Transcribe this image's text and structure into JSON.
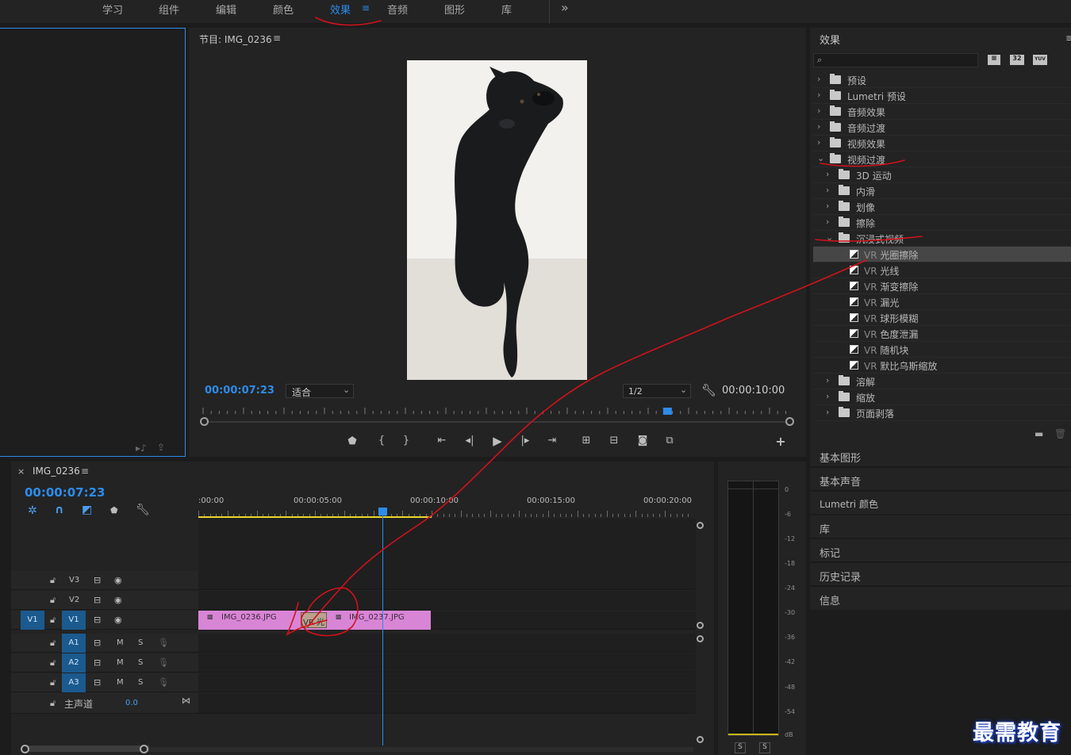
{
  "workspaces": {
    "tabs": [
      "学习",
      "组件",
      "编辑",
      "颜色",
      "效果",
      "音频",
      "图形",
      "库"
    ],
    "active": "效果",
    "more": "»"
  },
  "program": {
    "title": "节目: IMG_0236",
    "timecode": "00:00:07:23",
    "fit": "适合",
    "resolution": "1/2",
    "duration": "00:00:10:00",
    "playhead_fraction": 0.79
  },
  "effects": {
    "title": "效果",
    "search_placeholder": "",
    "filter_badges": [
      "32",
      "YUV"
    ],
    "tree": [
      {
        "label": "预设",
        "level": 0,
        "expanded": false,
        "kind": "preset"
      },
      {
        "label": "Lumetri 预设",
        "level": 0,
        "expanded": false,
        "kind": "preset"
      },
      {
        "label": "音频效果",
        "level": 0,
        "expanded": false,
        "kind": "folder"
      },
      {
        "label": "音频过渡",
        "level": 0,
        "expanded": false,
        "kind": "folder"
      },
      {
        "label": "视频效果",
        "level": 0,
        "expanded": false,
        "kind": "folder"
      },
      {
        "label": "视频过渡",
        "level": 0,
        "expanded": true,
        "kind": "folder"
      },
      {
        "label": "3D 运动",
        "level": 1,
        "expanded": false,
        "kind": "folder"
      },
      {
        "label": "内滑",
        "level": 1,
        "expanded": false,
        "kind": "folder"
      },
      {
        "label": "划像",
        "level": 1,
        "expanded": false,
        "kind": "folder"
      },
      {
        "label": "擦除",
        "level": 1,
        "expanded": false,
        "kind": "folder"
      },
      {
        "label": "沉浸式视频",
        "level": 1,
        "expanded": true,
        "kind": "folder"
      },
      {
        "prefix": "VR",
        "label": "光圈擦除",
        "level": 2,
        "kind": "fx",
        "selected": true
      },
      {
        "prefix": "VR",
        "label": "光线",
        "level": 2,
        "kind": "fx"
      },
      {
        "prefix": "VR",
        "label": "渐变擦除",
        "level": 2,
        "kind": "fx"
      },
      {
        "prefix": "VR",
        "label": "漏光",
        "level": 2,
        "kind": "fx"
      },
      {
        "prefix": "VR",
        "label": "球形模糊",
        "level": 2,
        "kind": "fx"
      },
      {
        "prefix": "VR",
        "label": "色度泄漏",
        "level": 2,
        "kind": "fx"
      },
      {
        "prefix": "VR",
        "label": "随机块",
        "level": 2,
        "kind": "fx"
      },
      {
        "prefix": "VR",
        "label": "默比乌斯缩放",
        "level": 2,
        "kind": "fx"
      },
      {
        "label": "溶解",
        "level": 1,
        "expanded": false,
        "kind": "folder"
      },
      {
        "label": "缩放",
        "level": 1,
        "expanded": false,
        "kind": "folder"
      },
      {
        "label": "页面剥落",
        "level": 1,
        "expanded": false,
        "kind": "folder"
      }
    ]
  },
  "side_panels": [
    "基本图形",
    "基本声音",
    "Lumetri 颜色",
    "库",
    "标记",
    "历史记录",
    "信息"
  ],
  "timeline": {
    "sequence": "IMG_0236",
    "timecode": "00:00:07:23",
    "ruler_labels": [
      ":00:00",
      "00:00:05:00",
      "00:00:10:00",
      "00:00:15:00",
      "00:00:20:00"
    ],
    "source_patch": "V1",
    "video_tracks": [
      "V3",
      "V2",
      "V1"
    ],
    "audio_tracks": [
      "A1",
      "A2",
      "A3"
    ],
    "mute_label": "M",
    "solo_label": "S",
    "master": {
      "label": "主声道",
      "value": "0.0"
    },
    "clips": [
      {
        "name": "IMG_0236.JPG",
        "track": "V1"
      },
      {
        "name": "IMG_0237.JPG",
        "track": "V1"
      }
    ],
    "transition": "VR 光"
  },
  "meters": {
    "db_labels": [
      "0",
      "-6",
      "-12",
      "-18",
      "-24",
      "-30",
      "-36",
      "-42",
      "-48",
      "-54",
      "dB"
    ],
    "solo_buttons": [
      "S",
      "S"
    ]
  },
  "watermark": "最需教育",
  "colors": {
    "accent": "#2d8ceb",
    "clip": "#d985d6",
    "annotation": "#d0121b",
    "track_target": "#1b5a8e"
  }
}
